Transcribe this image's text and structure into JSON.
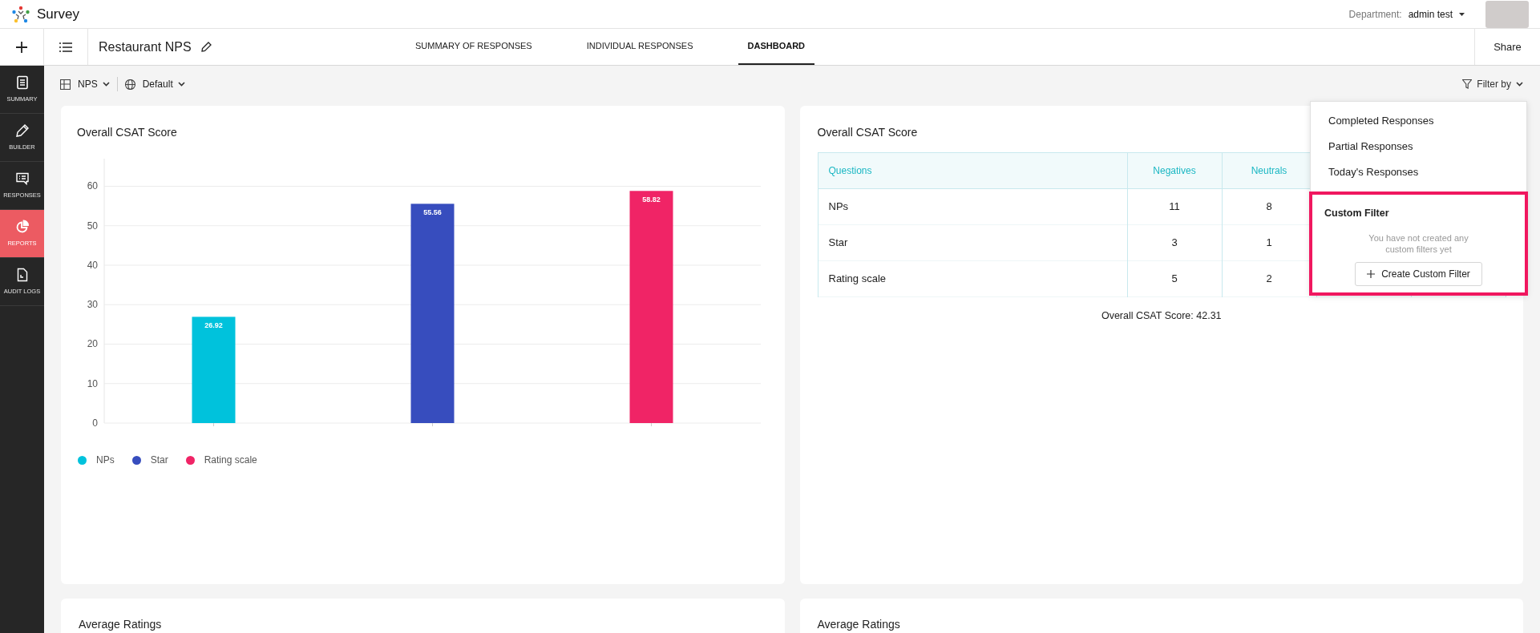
{
  "header": {
    "app_name": "Survey",
    "department_label": "Department:",
    "department_value": "admin test"
  },
  "survey_bar": {
    "survey_name": "Restaurant NPS",
    "share": "Share"
  },
  "tabs": [
    {
      "label": "SUMMARY OF RESPONSES",
      "selected": false
    },
    {
      "label": "INDIVIDUAL RESPONSES",
      "selected": false
    },
    {
      "label": "DASHBOARD",
      "selected": true
    }
  ],
  "sidebar": {
    "items": [
      {
        "label": "SUMMARY",
        "selected": false
      },
      {
        "label": "BUILDER",
        "selected": false
      },
      {
        "label": "RESPONSES",
        "selected": false
      },
      {
        "label": "REPORTS",
        "selected": true
      },
      {
        "label": "AUDIT LOGS",
        "selected": false
      }
    ]
  },
  "toolbar": {
    "view": "NPS",
    "language": "Default",
    "filter": "Filter by"
  },
  "filter_menu": {
    "items": [
      "Completed Responses",
      "Partial Responses",
      "Today's Responses"
    ],
    "custom_filter": {
      "title": "Custom Filter",
      "message": "You have not created any custom filters yet",
      "button": "Create Custom Filter"
    }
  },
  "chart_card": {
    "title": "Overall CSAT Score",
    "chart_data": {
      "type": "bar",
      "grid": true,
      "legend": true,
      "ylim": [
        0,
        67
      ],
      "yticks": [
        0,
        10,
        20,
        30,
        40,
        50,
        60
      ],
      "data_labels": true,
      "series": [
        {
          "name": "NPs",
          "color": "#00c2dc",
          "values": [
            26.92
          ]
        },
        {
          "name": "Star",
          "color": "#374dbe",
          "values": [
            55.56
          ]
        },
        {
          "name": "Rating scale",
          "color": "#f02466",
          "values": [
            58.82
          ]
        }
      ]
    }
  },
  "table_card": {
    "title": "Overall CSAT Score",
    "columns": [
      "Questions",
      "Negatives",
      "Neutrals"
    ],
    "rows": [
      [
        "NPs",
        "11",
        "8"
      ],
      [
        "Star",
        "3",
        "1"
      ],
      [
        "Rating scale",
        "5",
        "2"
      ]
    ],
    "summary": "Overall CSAT Score: 42.31"
  },
  "bottom_cards": [
    {
      "title": "Average Ratings"
    },
    {
      "title": "Average Ratings"
    }
  ]
}
